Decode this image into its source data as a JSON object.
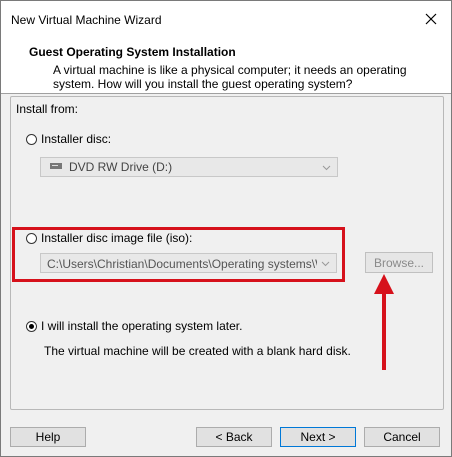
{
  "window": {
    "title": "New Virtual Machine Wizard"
  },
  "header": {
    "title": "Guest Operating System Installation",
    "description": "A virtual machine is like a physical computer; it needs an operating system. How will you install the guest operating system?"
  },
  "install_from": {
    "label": "Install from:",
    "options": [
      {
        "label": "Installer disc:",
        "selected": false
      },
      {
        "label": "Installer disc image file (iso):",
        "selected": false
      },
      {
        "label": "I will install the operating system later.",
        "selected": true
      }
    ],
    "disc_drive": {
      "value": "DVD RW Drive (D:)",
      "icon": "dvd-drive-icon"
    },
    "iso_path": {
      "value": "C:\\Users\\Christian\\Documents\\Operating systems\\Win"
    },
    "browse_label": "Browse...",
    "later_description": "The virtual machine will be created with a blank hard disk."
  },
  "footer": {
    "help": "Help",
    "back": "< Back",
    "next": "Next >",
    "cancel": "Cancel"
  },
  "annotation": {
    "color": "#d6111b"
  }
}
